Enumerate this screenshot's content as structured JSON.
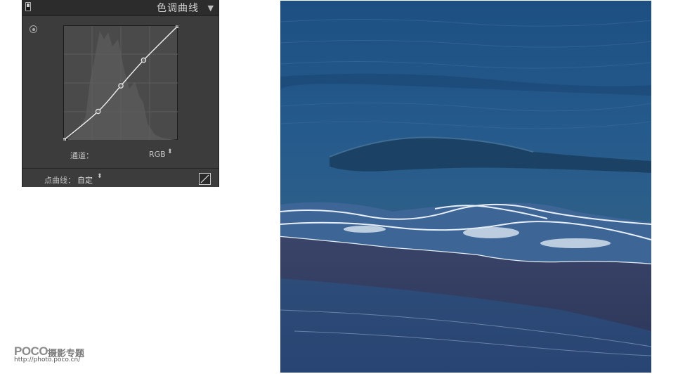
{
  "panel": {
    "title": "色调曲线",
    "collapse_glyph": "▼",
    "channel_label": "通道：",
    "channel_value": "RGB",
    "point_curve_label": "点曲线：",
    "point_curve_value": "自定",
    "stepper_glyph": "⬍",
    "icons": [
      "panel-switch-icon",
      "target-adjust-icon",
      "edit-point-curve-icon"
    ]
  },
  "curve": {
    "points": [
      [
        0,
        0
      ],
      [
        0.3,
        0.25
      ],
      [
        0.5,
        0.475
      ],
      [
        0.7,
        0.7
      ],
      [
        1,
        1
      ]
    ]
  },
  "logo": {
    "word": "POCO",
    "subtitle": "摄影专题",
    "url": "http://photo.poco.cn/"
  },
  "colors": {
    "panel_bg": "#3c3c3c",
    "curve_bg": "#4a4a4a",
    "curve_line": "#f0f0f0",
    "sea_deep": "#1b4a7a",
    "sand": "#2e3a5e"
  }
}
